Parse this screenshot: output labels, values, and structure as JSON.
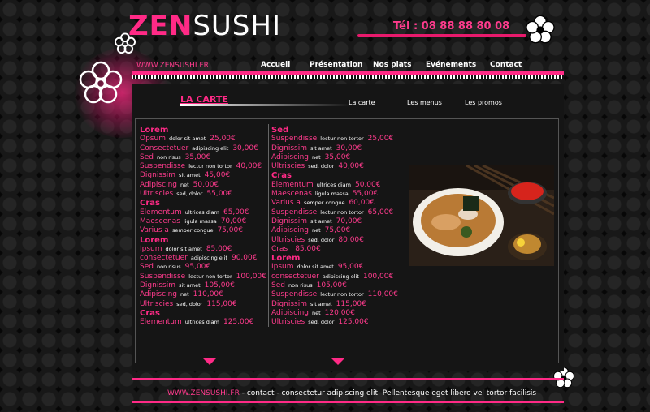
{
  "header": {
    "logo_zen": "ZEN",
    "logo_sushi": "SUSHI",
    "tel": "Tél : 08 88 88 80 08",
    "site_url": "WWW.ZENSUSHI.FR"
  },
  "nav": [
    "Accueil",
    "Présentation",
    "Nos plats",
    "Evénements",
    "Contact"
  ],
  "section": {
    "title": "LA CARTE",
    "tabs": [
      "La carte",
      "Les menus",
      "Les promos"
    ]
  },
  "menu_left": [
    {
      "type": "section",
      "name": "Lorem"
    },
    {
      "name": "Opsum",
      "desc": "dolor sit amet",
      "price": "25,00€"
    },
    {
      "name": "Consectetuer",
      "desc": "adipiscing elit",
      "price": "30,00€"
    },
    {
      "name": "Sed",
      "desc": "non risus",
      "price": "35,00€"
    },
    {
      "name": "Suspendisse",
      "desc": "lectur non tortor",
      "price": "40,00€"
    },
    {
      "name": "Dignissim",
      "desc": "sit amet",
      "price": "45,00€"
    },
    {
      "name": "Adipiscing",
      "desc": "net",
      "price": "50,00€"
    },
    {
      "name": "Ultriscies",
      "desc": "sed, dolor",
      "price": "55,00€"
    },
    {
      "type": "section",
      "name": "Cras"
    },
    {
      "name": "Elementum",
      "desc": "ultrices diam",
      "price": "65,00€"
    },
    {
      "name": "Maescenas",
      "desc": "ligula massa",
      "price": "70,00€"
    },
    {
      "name": "Varius a",
      "desc": "semper congue",
      "price": "75,00€"
    },
    {
      "type": "section",
      "name": "Lorem"
    },
    {
      "name": "Ipsum",
      "desc": "dolor sit amet",
      "price": "85,00€"
    },
    {
      "name": "consectetuer",
      "desc": "adipiscing elit",
      "price": "90,00€"
    },
    {
      "name": "Sed",
      "desc": "non risus",
      "price": "95,00€"
    },
    {
      "name": "Suspendisse",
      "desc": "lectur non tortor",
      "price": "100,00€"
    },
    {
      "name": "Dignissim",
      "desc": "sit amet",
      "price": "105,00€"
    },
    {
      "name": "Adipiscing",
      "desc": "net",
      "price": "110,00€"
    },
    {
      "name": "Ultriscies",
      "desc": "sed, dolor",
      "price": "115,00€"
    },
    {
      "type": "section",
      "name": "Cras"
    },
    {
      "name": "Elementum",
      "desc": "ultrices diam",
      "price": "125,00€"
    }
  ],
  "menu_right": [
    {
      "type": "section",
      "name": "Sed"
    },
    {
      "name": "Suspendisse",
      "desc": "lectur non tortor",
      "price": "25,00€"
    },
    {
      "name": "Dignissim",
      "desc": "sit amet",
      "price": "30,00€"
    },
    {
      "name": "Adipiscing",
      "desc": "net",
      "price": "35,00€"
    },
    {
      "name": "Ultriscies",
      "desc": "sed, dolor",
      "price": "40,00€"
    },
    {
      "type": "section",
      "name": "Cras"
    },
    {
      "name": "Elementum",
      "desc": "ultrices diam",
      "price": "50,00€"
    },
    {
      "name": "Maescenas",
      "desc": "ligula massa",
      "price": "55,00€"
    },
    {
      "name": "Varius a",
      "desc": "semper congue",
      "price": "60,00€"
    },
    {
      "name": "Suspendisse",
      "desc": "lectur non tortor",
      "price": "65,00€"
    },
    {
      "name": "Dignissim",
      "desc": "sit amet",
      "price": "70,00€"
    },
    {
      "name": "Adipiscing",
      "desc": "net",
      "price": "75,00€"
    },
    {
      "name": "Ultriscies",
      "desc": "sed, dolor",
      "price": "80,00€"
    },
    {
      "name": "Cras",
      "desc": "",
      "price": "85,00€"
    },
    {
      "type": "section",
      "name": "Lorem"
    },
    {
      "name": "Ipsum",
      "desc": "dolor sit amet",
      "price": "95,00€"
    },
    {
      "name": "consectetuer",
      "desc": "adipiscing elit",
      "price": "100,00€"
    },
    {
      "name": "Sed",
      "desc": "non risus",
      "price": "105,00€"
    },
    {
      "name": "Suspendisse",
      "desc": "lectur non tortor",
      "price": "110,00€"
    },
    {
      "name": "Dignissim",
      "desc": "sit amet",
      "price": "115,00€"
    },
    {
      "name": "Adipiscing",
      "desc": "net",
      "price": "120,00€"
    },
    {
      "name": "Ultriscies",
      "desc": "sed, dolor",
      "price": "125,00€"
    }
  ],
  "footer": {
    "site": "WWW.ZENSUSHI.FR",
    "text": " - contact - consectetur adipiscing elit. Pellentesque eget libero vel tortor facilisis"
  },
  "colors": {
    "accent": "#ff2a86",
    "background": "#0a0a0a"
  },
  "icons": [
    "flower-icon",
    "scroll-down-arrow-icon"
  ]
}
